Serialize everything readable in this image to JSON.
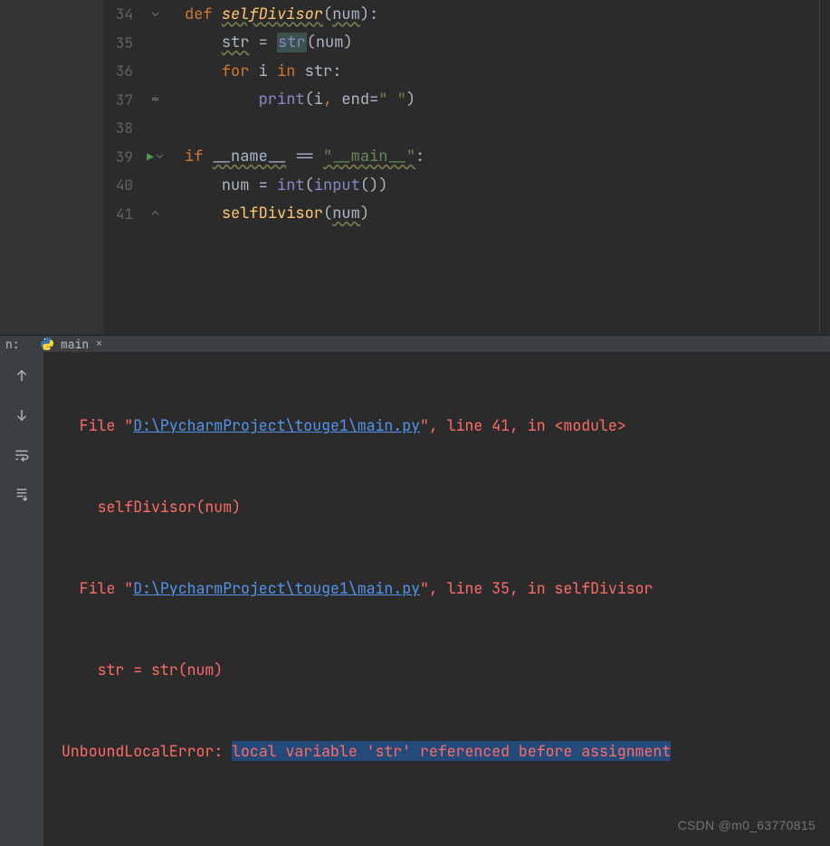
{
  "lines": [
    {
      "n": 34,
      "fold": "open",
      "run": false
    },
    {
      "n": 35,
      "fold": "",
      "run": false
    },
    {
      "n": 36,
      "fold": "",
      "run": false
    },
    {
      "n": 37,
      "fold": "mid",
      "run": false
    },
    {
      "n": 38,
      "fold": "",
      "run": false
    },
    {
      "n": 39,
      "fold": "open",
      "run": true
    },
    {
      "n": 40,
      "fold": "",
      "run": false
    },
    {
      "n": 41,
      "fold": "close",
      "run": false
    }
  ],
  "code": {
    "l34": {
      "kw_def": "def ",
      "fn": "selfDivisor",
      "op1": "(",
      "param": "num",
      "op2": "):"
    },
    "l35": {
      "ind": "    ",
      "lhs": "str",
      "op": " = ",
      "bi": "str",
      "rest": "(num)"
    },
    "l36": {
      "ind": "    ",
      "kw_for": "for ",
      "var": "i ",
      "kw_in": "in ",
      "seq": "str",
      "col": ":"
    },
    "l37": {
      "ind": "        ",
      "bi": "print",
      "op1": "(i",
      "comma": ", ",
      "kwarg": "end",
      "eq": "=",
      "strv": "\" \"",
      "op2": ")"
    },
    "l38": {
      "blank": ""
    },
    "l39": {
      "kw_if": "if ",
      "name": "__name__",
      "op": " == ",
      "strv": "\"__main__\"",
      "col": ":"
    },
    "l40": {
      "ind": "    ",
      "lhs": "num = ",
      "bi1": "int",
      "op1": "(",
      "bi2": "input",
      "op2": "())"
    },
    "l41": {
      "ind": "    ",
      "fn": "selfDivisor",
      "op1": "(",
      "arg": "num",
      "op2": ")"
    }
  },
  "panel": {
    "tab_name": "main",
    "side_label": "n:"
  },
  "console": {
    "l1a": "  File \"",
    "l1b": "D:\\PycharmProject\\touge1\\main.py",
    "l1c": "\", line 41, in <module>",
    "l2": "    selfDivisor(num)",
    "l3a": "  File \"",
    "l3b": "D:\\PycharmProject\\touge1\\main.py",
    "l3c": "\", line 35, in selfDivisor",
    "l4": "    str = str(num)",
    "l5a": "UnboundLocalError",
    "l5b": ": ",
    "l5c": "local variable 'str' referenced before assignment"
  },
  "watermark": "CSDN @m0_63770815"
}
